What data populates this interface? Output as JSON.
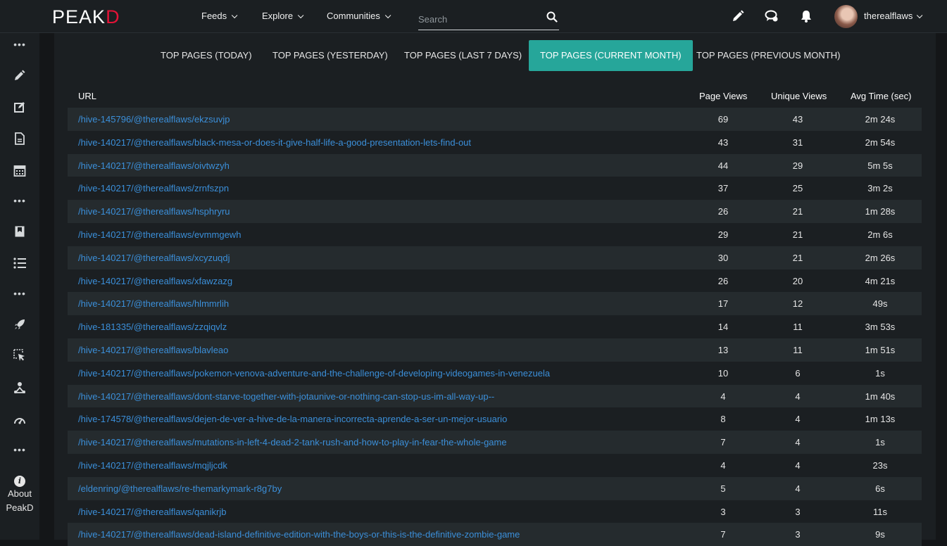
{
  "header": {
    "logo_left": "PE",
    "logo_mid": "A",
    "logo_right": "K",
    "logo_end": "D",
    "nav": [
      "Feeds",
      "Explore",
      "Communities"
    ],
    "search_placeholder": "Search",
    "username": "therealflaws",
    "icons": [
      "pencil-icon",
      "chat-icon",
      "bell-icon"
    ]
  },
  "sidebar": {
    "about_label_1": "About",
    "about_label_2": "PeakD",
    "icons": [
      "more-dots-icon",
      "pencil-icon",
      "edit-square-icon",
      "document-icon",
      "calendar-icon",
      "more-dots-icon",
      "bookmark-book-icon",
      "list-icon",
      "more-dots-icon",
      "rocket-icon",
      "cursor-select-icon",
      "community-icon",
      "gauge-icon",
      "more-dots-icon",
      "info-icon"
    ]
  },
  "tabs": [
    {
      "label": "TOP PAGES (TODAY)",
      "active": false
    },
    {
      "label": "TOP PAGES (YESTERDAY)",
      "active": false
    },
    {
      "label": "TOP PAGES (LAST 7 DAYS)",
      "active": false
    },
    {
      "label": "TOP PAGES (CURRENT MONTH)",
      "active": true
    },
    {
      "label": "TOP PAGES (PREVIOUS MONTH)",
      "active": false
    }
  ],
  "table": {
    "columns": [
      "URL",
      "Page Views",
      "Unique Views",
      "Avg Time (sec)"
    ],
    "rows": [
      {
        "url": "/hive-145796/@therealflaws/ekzsuvjp",
        "pv": "69",
        "uv": "43",
        "at": "2m 24s"
      },
      {
        "url": "/hive-140217/@therealflaws/black-mesa-or-does-it-give-half-life-a-good-presentation-lets-find-out",
        "pv": "43",
        "uv": "31",
        "at": "2m 54s"
      },
      {
        "url": "/hive-140217/@therealflaws/oivtwzyh",
        "pv": "44",
        "uv": "29",
        "at": "5m 5s"
      },
      {
        "url": "/hive-140217/@therealflaws/zrnfszpn",
        "pv": "37",
        "uv": "25",
        "at": "3m 2s"
      },
      {
        "url": "/hive-140217/@therealflaws/hsphryru",
        "pv": "26",
        "uv": "21",
        "at": "1m 28s"
      },
      {
        "url": "/hive-140217/@therealflaws/evmmgewh",
        "pv": "29",
        "uv": "21",
        "at": "2m 6s"
      },
      {
        "url": "/hive-140217/@therealflaws/xcyzuqdj",
        "pv": "30",
        "uv": "21",
        "at": "2m 26s"
      },
      {
        "url": "/hive-140217/@therealflaws/xfawzazg",
        "pv": "26",
        "uv": "20",
        "at": "4m 21s"
      },
      {
        "url": "/hive-140217/@therealflaws/hlmmrlih",
        "pv": "17",
        "uv": "12",
        "at": "49s"
      },
      {
        "url": "/hive-181335/@therealflaws/zzqiqvlz",
        "pv": "14",
        "uv": "11",
        "at": "3m 53s"
      },
      {
        "url": "/hive-140217/@therealflaws/blavleao",
        "pv": "13",
        "uv": "11",
        "at": "1m 51s"
      },
      {
        "url": "/hive-140217/@therealflaws/pokemon-venova-adventure-and-the-challenge-of-developing-videogames-in-venezuela",
        "pv": "10",
        "uv": "6",
        "at": "1s"
      },
      {
        "url": "/hive-140217/@therealflaws/dont-starve-together-with-jotaunive-or-nothing-can-stop-us-im-all-way-up--",
        "pv": "4",
        "uv": "4",
        "at": "1m 40s"
      },
      {
        "url": "/hive-174578/@therealflaws/dejen-de-ver-a-hive-de-la-manera-incorrecta-aprende-a-ser-un-mejor-usuario",
        "pv": "8",
        "uv": "4",
        "at": "1m 13s"
      },
      {
        "url": "/hive-140217/@therealflaws/mutations-in-left-4-dead-2-tank-rush-and-how-to-play-in-fear-the-whole-game",
        "pv": "7",
        "uv": "4",
        "at": "1s"
      },
      {
        "url": "/hive-140217/@therealflaws/mqjljcdk",
        "pv": "4",
        "uv": "4",
        "at": "23s"
      },
      {
        "url": "/eldenring/@therealflaws/re-themarkymark-r8g7by",
        "pv": "5",
        "uv": "4",
        "at": "6s"
      },
      {
        "url": "/hive-140217/@therealflaws/qanikrjb",
        "pv": "3",
        "uv": "3",
        "at": "11s"
      },
      {
        "url": "/hive-140217/@therealflaws/dead-island-definitive-edition-with-the-boys-or-this-is-the-definitive-zombie-game",
        "pv": "7",
        "uv": "3",
        "at": "9s"
      }
    ]
  },
  "colors": {
    "accent": "#26a69a",
    "link": "#3b8fd9",
    "logo_red": "#e31337"
  }
}
